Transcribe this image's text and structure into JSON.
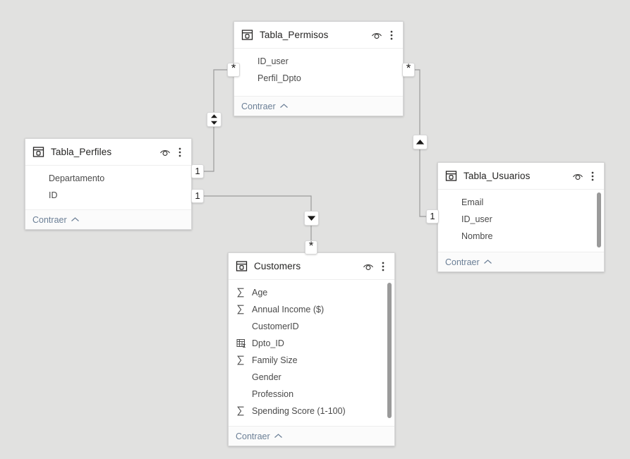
{
  "app": {
    "view_name": "model-relationship-diagram",
    "canvas_background": "#e1e1e0"
  },
  "tables": [
    {
      "id": "tabla-permisos",
      "name": "Tabla_Permisos",
      "icon": "table-icon",
      "hide_icon": "eye-icon",
      "menu_icon": "more-options-icon",
      "collapse_label": "Contraer",
      "collapse_icon": "chevron-up-icon",
      "scrollbar": false,
      "fields": [
        {
          "name": "ID_user",
          "icon": "text-field-icon"
        },
        {
          "name": "Perfil_Dpto",
          "icon": "text-field-icon"
        }
      ]
    },
    {
      "id": "tabla-perfiles",
      "name": "Tabla_Perfiles",
      "icon": "table-icon",
      "hide_icon": "eye-icon",
      "menu_icon": "more-options-icon",
      "collapse_label": "Contraer",
      "collapse_icon": "chevron-up-icon",
      "scrollbar": false,
      "fields": [
        {
          "name": "Departamento",
          "icon": "text-field-icon"
        },
        {
          "name": "ID",
          "icon": "text-field-icon"
        }
      ]
    },
    {
      "id": "tabla-usuarios",
      "name": "Tabla_Usuarios",
      "icon": "table-icon",
      "hide_icon": "eye-icon",
      "menu_icon": "more-options-icon",
      "collapse_label": "Contraer",
      "collapse_icon": "chevron-up-icon",
      "scrollbar": true,
      "fields": [
        {
          "name": "Email",
          "icon": "text-field-icon"
        },
        {
          "name": "ID_user",
          "icon": "text-field-icon"
        },
        {
          "name": "Nombre",
          "icon": "text-field-icon"
        }
      ]
    },
    {
      "id": "customers",
      "name": "Customers",
      "icon": "table-icon",
      "hide_icon": "eye-icon",
      "menu_icon": "more-options-icon",
      "collapse_label": "Contraer",
      "collapse_icon": "chevron-up-icon",
      "scrollbar": true,
      "fields": [
        {
          "name": "Age",
          "icon": "sigma-icon"
        },
        {
          "name": "Annual Income ($)",
          "icon": "sigma-icon"
        },
        {
          "name": "CustomerID",
          "icon": "text-field-icon"
        },
        {
          "name": "Dpto_ID",
          "icon": "calculated-column-icon"
        },
        {
          "name": "Family Size",
          "icon": "sigma-icon"
        },
        {
          "name": "Gender",
          "icon": "text-field-icon"
        },
        {
          "name": "Profession",
          "icon": "text-field-icon"
        },
        {
          "name": "Spending Score (1-100)",
          "icon": "sigma-icon"
        }
      ]
    }
  ],
  "relationships": [
    {
      "id": "permisos-perfiles",
      "from_table": "Tabla_Permisos",
      "to_table": "Tabla_Perfiles",
      "from_cardinality": "*",
      "to_cardinality": "1",
      "cross_filter_icon": "both-directions-icon"
    },
    {
      "id": "permisos-usuarios",
      "from_table": "Tabla_Permisos",
      "to_table": "Tabla_Usuarios",
      "from_cardinality": "*",
      "to_cardinality": "1",
      "cross_filter_icon": "arrow-up-icon"
    },
    {
      "id": "perfiles-customers",
      "from_table": "Tabla_Perfiles",
      "to_table": "Customers",
      "from_cardinality": "1",
      "to_cardinality": "*",
      "cross_filter_icon": "arrow-down-icon"
    }
  ]
}
